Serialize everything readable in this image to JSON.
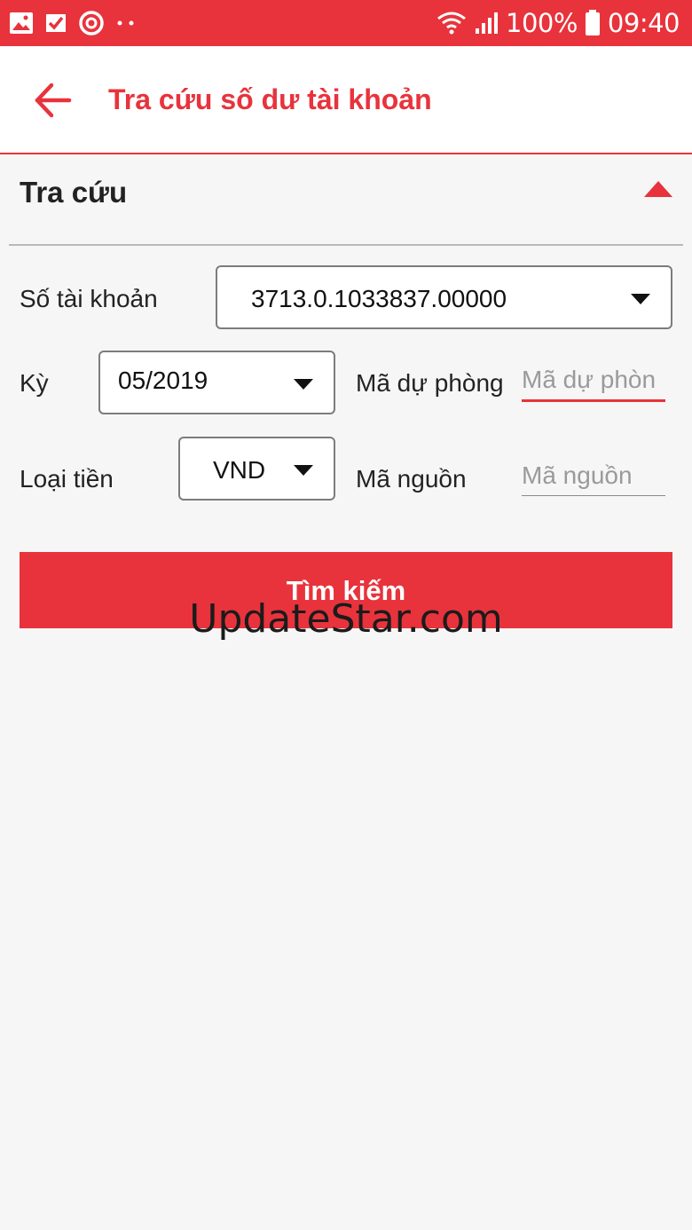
{
  "status_bar": {
    "battery": "100%",
    "time": "09:40",
    "icons": [
      "gallery-icon",
      "check-icon",
      "sync-icon",
      "more-dots-icon",
      "wifi-icon",
      "signal-icon",
      "battery-icon"
    ]
  },
  "app_bar": {
    "title": "Tra cứu số dư tài khoản",
    "back_icon": "arrow-left-icon"
  },
  "section": {
    "title": "Tra cứu",
    "toggle_icon": "triangle-up-icon"
  },
  "form": {
    "account": {
      "label": "Số tài khoản",
      "value": "3713.0.1033837.00000"
    },
    "period": {
      "label": "Kỳ",
      "value": "05/2019"
    },
    "backup_code": {
      "label": "Mã dự phòng",
      "placeholder": "Mã dự phòn"
    },
    "currency": {
      "label": "Loại tiền",
      "value": "VND"
    },
    "source_code": {
      "label": "Mã nguồn",
      "placeholder": "Mã nguồn"
    }
  },
  "search_button": {
    "label": "Tìm kiếm"
  },
  "watermark": "UpdateStar.com",
  "colors": {
    "accent": "#e8333c",
    "background": "#f6f6f6",
    "border": "#7c7c7c",
    "placeholder": "#9a9a9a"
  }
}
